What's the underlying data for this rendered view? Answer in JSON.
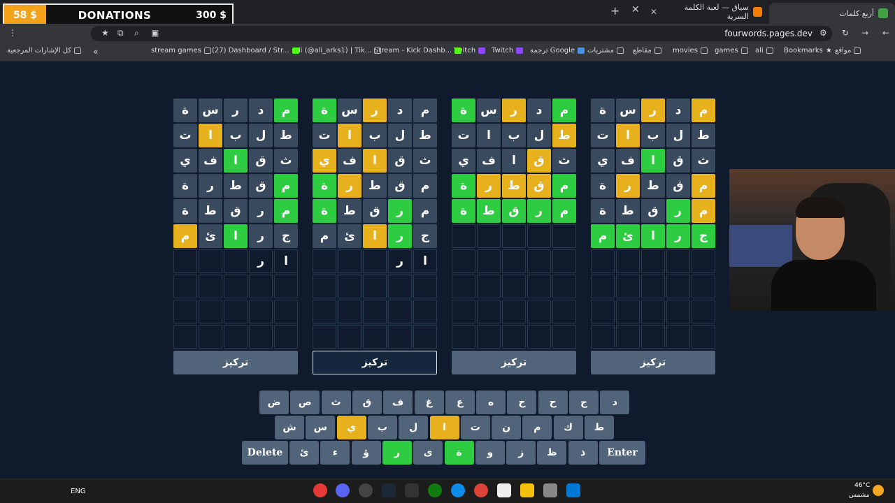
{
  "donation": {
    "amount": "58 $",
    "title": "DONATIONS",
    "goal": "300 $"
  },
  "tabs": [
    {
      "title": "أربع كلمات",
      "fav": "#43a047"
    },
    {
      "title": "سياق — لعبة الكلمة السرية",
      "fav": "#f57c00"
    }
  ],
  "browser": {
    "url": "fourwords.pages.dev"
  },
  "bookmarks": [
    "Bookmarks",
    "ali",
    "games",
    "movies",
    "مقاطع",
    "مشتريات",
    "ترجمة Google",
    "Twitch",
    "Twitch",
    "Stream - Kick Dashb...",
    "Ali (@ali_arks1) | Tik...",
    "(27) Dashboard / Str...",
    "stream games",
    "كل الإشارات المرجعية",
    "مواقع"
  ],
  "boards": [
    {
      "focus_label": "تركيز",
      "rows": [
        [
          [
            "ة",
            "x"
          ],
          [
            "س",
            "x"
          ],
          [
            "ر",
            "x"
          ],
          [
            "د",
            "x"
          ],
          [
            "م",
            "g"
          ]
        ],
        [
          [
            "ت",
            "x"
          ],
          [
            "ا",
            "y"
          ],
          [
            "ب",
            "x"
          ],
          [
            "ل",
            "x"
          ],
          [
            "ط",
            "x"
          ]
        ],
        [
          [
            "ي",
            "x"
          ],
          [
            "ف",
            "x"
          ],
          [
            "ا",
            "g"
          ],
          [
            "ق",
            "x"
          ],
          [
            "ث",
            "x"
          ]
        ],
        [
          [
            "ة",
            "x"
          ],
          [
            "ر",
            "x"
          ],
          [
            "ط",
            "x"
          ],
          [
            "ق",
            "x"
          ],
          [
            "م",
            "g"
          ]
        ],
        [
          [
            "ة",
            "x"
          ],
          [
            "ط",
            "x"
          ],
          [
            "ق",
            "x"
          ],
          [
            "ر",
            "x"
          ],
          [
            "م",
            "g"
          ]
        ],
        [
          [
            "م",
            "y"
          ],
          [
            "ئ",
            "x"
          ],
          [
            "ا",
            "g"
          ],
          [
            "ر",
            "x"
          ],
          [
            "ج",
            "x"
          ]
        ],
        [
          [
            "",
            "t"
          ],
          [
            "",
            "t"
          ],
          [
            "",
            "t"
          ],
          [
            "ر",
            "t"
          ],
          [
            "ا",
            "t"
          ]
        ],
        [
          [
            "",
            "e"
          ],
          [
            "",
            "e"
          ],
          [
            "",
            "e"
          ],
          [
            "",
            "e"
          ],
          [
            "",
            "e"
          ]
        ],
        [
          [
            "",
            "e"
          ],
          [
            "",
            "e"
          ],
          [
            "",
            "e"
          ],
          [
            "",
            "e"
          ],
          [
            "",
            "e"
          ]
        ],
        [
          [
            "",
            "e"
          ],
          [
            "",
            "e"
          ],
          [
            "",
            "e"
          ],
          [
            "",
            "e"
          ],
          [
            "",
            "e"
          ]
        ]
      ]
    },
    {
      "focus_label": "تركيز",
      "rows": [
        [
          [
            "ة",
            "g"
          ],
          [
            "س",
            "x"
          ],
          [
            "ر",
            "y"
          ],
          [
            "د",
            "x"
          ],
          [
            "م",
            "x"
          ]
        ],
        [
          [
            "ت",
            "x"
          ],
          [
            "ا",
            "y"
          ],
          [
            "ب",
            "x"
          ],
          [
            "ل",
            "x"
          ],
          [
            "ط",
            "x"
          ]
        ],
        [
          [
            "ي",
            "y"
          ],
          [
            "ف",
            "x"
          ],
          [
            "ا",
            "y"
          ],
          [
            "ق",
            "x"
          ],
          [
            "ث",
            "x"
          ]
        ],
        [
          [
            "ة",
            "g"
          ],
          [
            "ر",
            "y"
          ],
          [
            "ط",
            "x"
          ],
          [
            "ق",
            "x"
          ],
          [
            "م",
            "x"
          ]
        ],
        [
          [
            "ة",
            "g"
          ],
          [
            "ط",
            "x"
          ],
          [
            "ق",
            "x"
          ],
          [
            "ر",
            "g"
          ],
          [
            "م",
            "x"
          ]
        ],
        [
          [
            "م",
            "x"
          ],
          [
            "ئ",
            "x"
          ],
          [
            "ا",
            "y"
          ],
          [
            "ر",
            "g"
          ],
          [
            "ج",
            "x"
          ]
        ],
        [
          [
            "",
            "t"
          ],
          [
            "",
            "t"
          ],
          [
            "",
            "t"
          ],
          [
            "ر",
            "t"
          ],
          [
            "ا",
            "t"
          ]
        ],
        [
          [
            "",
            "e"
          ],
          [
            "",
            "e"
          ],
          [
            "",
            "e"
          ],
          [
            "",
            "e"
          ],
          [
            "",
            "e"
          ]
        ],
        [
          [
            "",
            "e"
          ],
          [
            "",
            "e"
          ],
          [
            "",
            "e"
          ],
          [
            "",
            "e"
          ],
          [
            "",
            "e"
          ]
        ],
        [
          [
            "",
            "e"
          ],
          [
            "",
            "e"
          ],
          [
            "",
            "e"
          ],
          [
            "",
            "e"
          ],
          [
            "",
            "e"
          ]
        ]
      ]
    },
    {
      "focus_label": "تركيز",
      "rows": [
        [
          [
            "ة",
            "g"
          ],
          [
            "س",
            "x"
          ],
          [
            "ر",
            "y"
          ],
          [
            "د",
            "x"
          ],
          [
            "م",
            "g"
          ]
        ],
        [
          [
            "ت",
            "x"
          ],
          [
            "ا",
            "x"
          ],
          [
            "ب",
            "x"
          ],
          [
            "ل",
            "x"
          ],
          [
            "ط",
            "y"
          ]
        ],
        [
          [
            "ي",
            "x"
          ],
          [
            "ف",
            "x"
          ],
          [
            "ا",
            "x"
          ],
          [
            "ق",
            "y"
          ],
          [
            "ث",
            "x"
          ]
        ],
        [
          [
            "ة",
            "g"
          ],
          [
            "ر",
            "y"
          ],
          [
            "ط",
            "y"
          ],
          [
            "ق",
            "y"
          ],
          [
            "م",
            "g"
          ]
        ],
        [
          [
            "ة",
            "g"
          ],
          [
            "ط",
            "g"
          ],
          [
            "ق",
            "g"
          ],
          [
            "ر",
            "g"
          ],
          [
            "م",
            "g"
          ]
        ],
        [
          [
            "",
            "e"
          ],
          [
            "",
            "e"
          ],
          [
            "",
            "e"
          ],
          [
            "",
            "e"
          ],
          [
            "",
            "e"
          ]
        ],
        [
          [
            "",
            "e"
          ],
          [
            "",
            "e"
          ],
          [
            "",
            "e"
          ],
          [
            "",
            "e"
          ],
          [
            "",
            "e"
          ]
        ],
        [
          [
            "",
            "e"
          ],
          [
            "",
            "e"
          ],
          [
            "",
            "e"
          ],
          [
            "",
            "e"
          ],
          [
            "",
            "e"
          ]
        ],
        [
          [
            "",
            "e"
          ],
          [
            "",
            "e"
          ],
          [
            "",
            "e"
          ],
          [
            "",
            "e"
          ],
          [
            "",
            "e"
          ]
        ],
        [
          [
            "",
            "e"
          ],
          [
            "",
            "e"
          ],
          [
            "",
            "e"
          ],
          [
            "",
            "e"
          ],
          [
            "",
            "e"
          ]
        ]
      ]
    },
    {
      "focus_label": "تركيز",
      "rows": [
        [
          [
            "ة",
            "x"
          ],
          [
            "س",
            "x"
          ],
          [
            "ر",
            "y"
          ],
          [
            "د",
            "x"
          ],
          [
            "م",
            "y"
          ]
        ],
        [
          [
            "ت",
            "x"
          ],
          [
            "ا",
            "y"
          ],
          [
            "ب",
            "x"
          ],
          [
            "ل",
            "x"
          ],
          [
            "ط",
            "x"
          ]
        ],
        [
          [
            "ي",
            "x"
          ],
          [
            "ف",
            "x"
          ],
          [
            "ا",
            "g"
          ],
          [
            "ق",
            "x"
          ],
          [
            "ث",
            "x"
          ]
        ],
        [
          [
            "ة",
            "x"
          ],
          [
            "ر",
            "y"
          ],
          [
            "ط",
            "x"
          ],
          [
            "ق",
            "x"
          ],
          [
            "م",
            "y"
          ]
        ],
        [
          [
            "ة",
            "x"
          ],
          [
            "ط",
            "x"
          ],
          [
            "ق",
            "x"
          ],
          [
            "ر",
            "g"
          ],
          [
            "م",
            "y"
          ]
        ],
        [
          [
            "م",
            "g"
          ],
          [
            "ئ",
            "g"
          ],
          [
            "ا",
            "g"
          ],
          [
            "ر",
            "g"
          ],
          [
            "ج",
            "g"
          ]
        ],
        [
          [
            "",
            "e"
          ],
          [
            "",
            "e"
          ],
          [
            "",
            "e"
          ],
          [
            "",
            "e"
          ],
          [
            "",
            "e"
          ]
        ],
        [
          [
            "",
            "e"
          ],
          [
            "",
            "e"
          ],
          [
            "",
            "e"
          ],
          [
            "",
            "e"
          ],
          [
            "",
            "e"
          ]
        ],
        [
          [
            "",
            "e"
          ],
          [
            "",
            "e"
          ],
          [
            "",
            "e"
          ],
          [
            "",
            "e"
          ],
          [
            "",
            "e"
          ]
        ],
        [
          [
            "",
            "e"
          ],
          [
            "",
            "e"
          ],
          [
            "",
            "e"
          ],
          [
            "",
            "e"
          ],
          [
            "",
            "e"
          ]
        ]
      ]
    }
  ],
  "keyboard": {
    "row1": [
      [
        "ض",
        ""
      ],
      [
        "ص",
        ""
      ],
      [
        "ث",
        ""
      ],
      [
        "ق",
        ""
      ],
      [
        "ف",
        ""
      ],
      [
        "غ",
        ""
      ],
      [
        "ع",
        ""
      ],
      [
        "ه",
        ""
      ],
      [
        "خ",
        ""
      ],
      [
        "ح",
        ""
      ],
      [
        "ج",
        ""
      ],
      [
        "د",
        ""
      ]
    ],
    "row2": [
      [
        "ش",
        ""
      ],
      [
        "س",
        ""
      ],
      [
        "ي",
        "y"
      ],
      [
        "ب",
        ""
      ],
      [
        "ل",
        ""
      ],
      [
        "ا",
        "y"
      ],
      [
        "ت",
        ""
      ],
      [
        "ن",
        ""
      ],
      [
        "م",
        ""
      ],
      [
        "ك",
        ""
      ],
      [
        "ط",
        ""
      ]
    ],
    "row3": [
      [
        "Delete",
        "wide"
      ],
      [
        "ئ",
        ""
      ],
      [
        "ء",
        ""
      ],
      [
        "ؤ",
        ""
      ],
      [
        "ر",
        "g"
      ],
      [
        "ى",
        ""
      ],
      [
        "ة",
        "g"
      ],
      [
        "و",
        ""
      ],
      [
        "ز",
        ""
      ],
      [
        "ظ",
        ""
      ],
      [
        "ذ",
        ""
      ],
      [
        "Enter",
        "wide"
      ]
    ]
  },
  "taskbar": {
    "lang": "ENG",
    "temp": "46°C",
    "weather": "مشمس"
  }
}
